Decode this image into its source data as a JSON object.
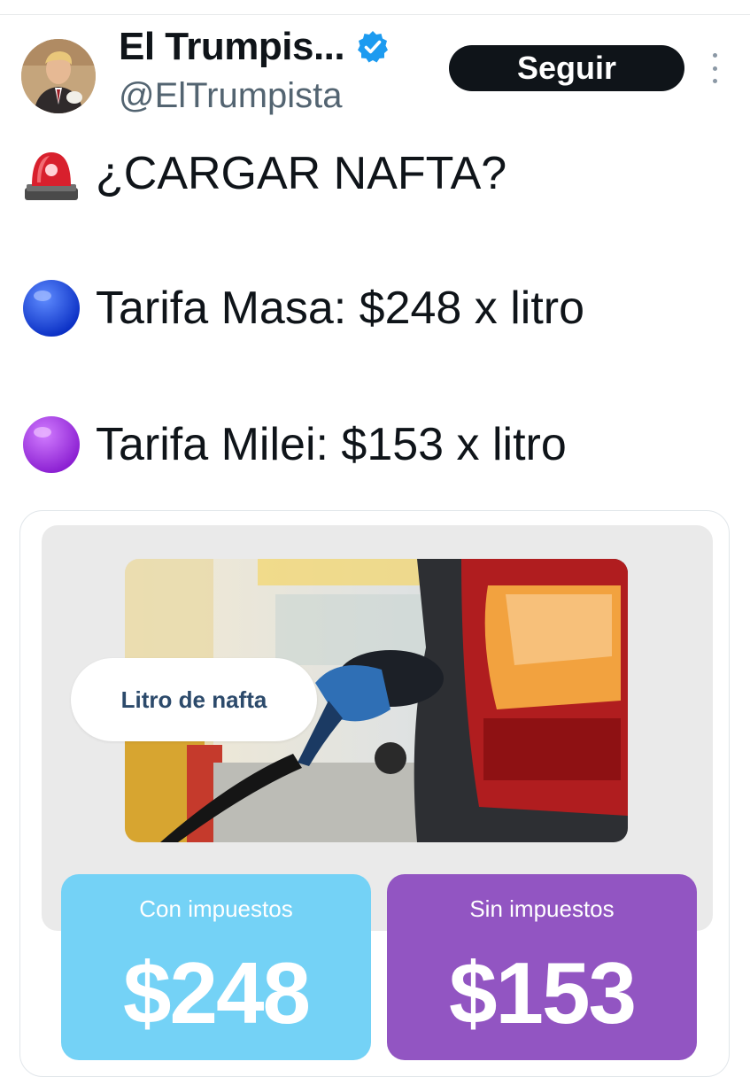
{
  "author": {
    "display_name": "El Trumpis...",
    "handle": "@ElTrumpista",
    "verified": true,
    "avatar_icon": "profile-photo"
  },
  "actions": {
    "follow_label": "Seguir",
    "more_icon": "more-vertical-icon"
  },
  "tweet": {
    "lines": [
      {
        "emoji": "rotating-light-emoji",
        "text": "¿CARGAR NAFTA?"
      },
      {
        "emoji": "blue-circle-emoji",
        "text": "Tarifa Masa: $248 x litro"
      },
      {
        "emoji": "purple-circle-emoji",
        "text": "Tarifa Milei: $153 x litro"
      }
    ]
  },
  "media": {
    "pill_label": "Litro de nafta",
    "con": {
      "label": "Con impuestos",
      "amount": "$248",
      "color": "#74d2f6"
    },
    "sin": {
      "label": "Sin impuestos",
      "amount": "$153",
      "color": "#9255c2"
    }
  },
  "colors": {
    "text": "#0f1419",
    "secondary": "#536471",
    "verified": "#1d9bf0",
    "follow_bg": "#0f1419"
  }
}
